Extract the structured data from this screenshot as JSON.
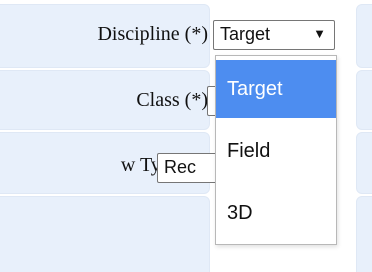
{
  "form": {
    "discipline": {
      "label": "Discipline (*)",
      "selected_value": "Target",
      "arrow_icon": "▼",
      "options": [
        "Target",
        "Field",
        "3D"
      ],
      "highlighted_option": "Target"
    },
    "class": {
      "label": "Class (*)"
    },
    "view_type": {
      "label": "w Type (*)",
      "visible_value": "Rec"
    }
  },
  "colors": {
    "panel": "#e8f0fb",
    "highlight": "#4d8df0"
  }
}
